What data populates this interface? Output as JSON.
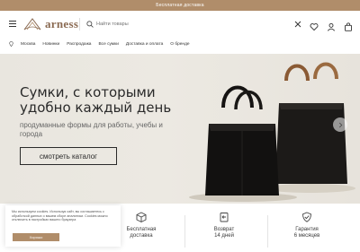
{
  "topbar": {
    "text": "Бесплатная доставка"
  },
  "header": {
    "logo_text": "arness",
    "search_placeholder": "Найти товары",
    "icons": [
      "menu-icon",
      "search-icon",
      "close-icon",
      "heart-icon",
      "user-icon",
      "bag-icon"
    ]
  },
  "nav": {
    "city": "Москва",
    "items": [
      "Новинки",
      "Распродажа",
      "Все сумки",
      "Доставка и оплата",
      "О бренде"
    ]
  },
  "hero": {
    "title": "Сумки, с которыми удобно каждый день",
    "subtitle": "продуманные формы для работы, учебы и города",
    "button_label": "смотреть каталог"
  },
  "features": [
    {
      "icon": "box-icon",
      "line1": "Бесплатная",
      "line2": "доставка"
    },
    {
      "icon": "return-icon",
      "line1": "Возврат",
      "line2": "14 дней"
    },
    {
      "icon": "shield-check-icon",
      "line1": "Гарантия",
      "line2": "6 месяцев"
    }
  ],
  "cookie": {
    "text": "Мы используем cookies. Используя сайт, вы соглашаетесь с обработкой данных о вашем сборе аналитики. Cookies можно отключить в настройках вашего браузера",
    "button_label": "Хорошо"
  },
  "colors": {
    "accent": "#b08d6a",
    "hero_bg": "#ebe8e1",
    "logo": "#8a6a52"
  }
}
